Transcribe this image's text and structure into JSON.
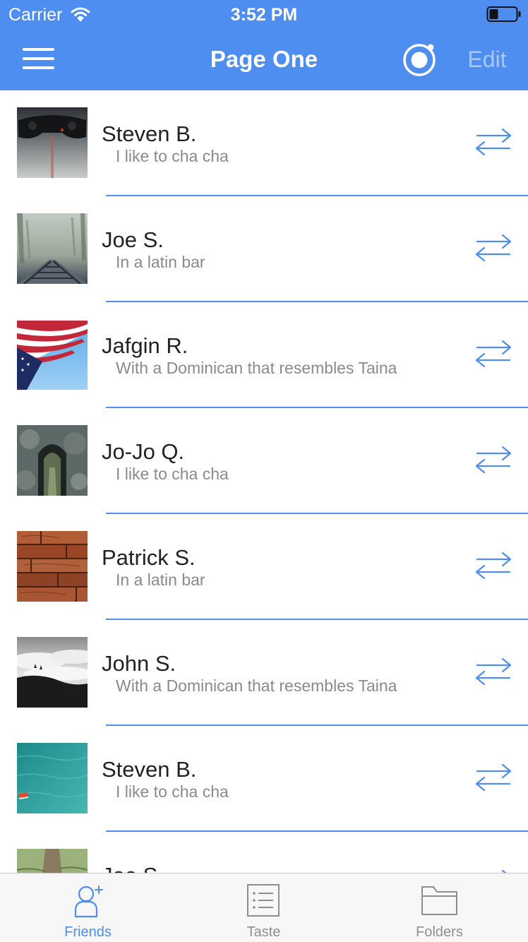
{
  "status_bar": {
    "carrier": "Carrier",
    "time": "3:52 PM"
  },
  "nav": {
    "title": "Page One",
    "edit_label": "Edit",
    "menu_icon": "hamburger-menu-icon",
    "record_icon": "record-icon"
  },
  "list": {
    "items": [
      {
        "name": "Steven B.",
        "subtitle": "I like to cha cha",
        "thumb": "game-controller"
      },
      {
        "name": "Joe S.",
        "subtitle": "In a latin bar",
        "thumb": "foggy-railroad"
      },
      {
        "name": "Jafgin R.",
        "subtitle": "With a Dominican that resembles Taina",
        "thumb": "american-flag"
      },
      {
        "name": "Jo-Jo Q.",
        "subtitle": "I like to cha cha",
        "thumb": "rock-tunnel"
      },
      {
        "name": "Patrick S.",
        "subtitle": "In a latin bar",
        "thumb": "wood-planks"
      },
      {
        "name": "John S.",
        "subtitle": "With a Dominican that resembles Taina",
        "thumb": "clouds-landscape"
      },
      {
        "name": "Steven B.",
        "subtitle": "I like to cha cha",
        "thumb": "turquoise-water"
      },
      {
        "name": "Joe S.",
        "subtitle": "",
        "thumb": "grass-path"
      }
    ]
  },
  "tabbar": {
    "tabs": [
      {
        "label": "Friends",
        "icon": "add-friend-icon",
        "active": true
      },
      {
        "label": "Taste",
        "icon": "list-icon",
        "active": false
      },
      {
        "label": "Folders",
        "icon": "folder-icon",
        "active": false
      }
    ]
  },
  "colors": {
    "accent": "#4e8ef0",
    "edit_text": "#a9c8f6",
    "name_text": "#222222",
    "subtitle_text": "#8a8a8a",
    "tab_inactive": "#8e8e93"
  }
}
